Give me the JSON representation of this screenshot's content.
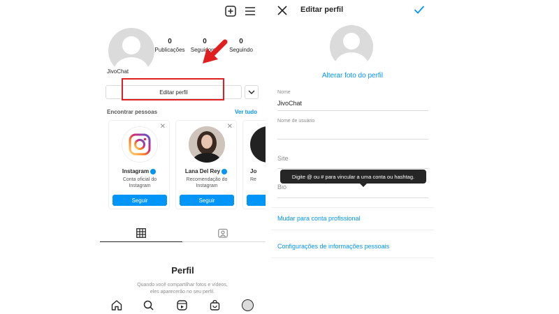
{
  "profile": {
    "stats": [
      {
        "value": "0",
        "label": "Publicações"
      },
      {
        "value": "0",
        "label": "Seguidores"
      },
      {
        "value": "0",
        "label": "Seguindo"
      }
    ],
    "username": "JivoChat",
    "edit_label": "Editar perfil",
    "find_people": "Encontrar pessoas",
    "see_all": "Ver tudo"
  },
  "suggestions": [
    {
      "name": "Instagram",
      "sub": "Conta oficial do Instagram",
      "button": "Seguir"
    },
    {
      "name": "Lana Del Rey",
      "sub": "Recomendação do Instagram",
      "button": "Seguir"
    },
    {
      "name": "Jo",
      "sub": "Re",
      "button": ""
    }
  ],
  "empty": {
    "title": "Perfil",
    "text": "Quando você compartilhar fotos e vídeos, eles aparecerão no seu perfil."
  },
  "edit": {
    "title": "Editar perfil",
    "change_photo": "Alterar foto do perfil",
    "name_label": "Nome",
    "name_value": "JivoChat",
    "username_label": "Nome de usuário",
    "site_placeholder": "Site",
    "bio_placeholder": "Bio",
    "tooltip": "Digite @ ou # para vincular a uma conta ou hashtag.",
    "pro_link": "Mudar para conta profissional",
    "personal_link": "Configurações de informações pessoais"
  },
  "colors": {
    "accent": "#0095f6",
    "highlight": "#e02020"
  }
}
